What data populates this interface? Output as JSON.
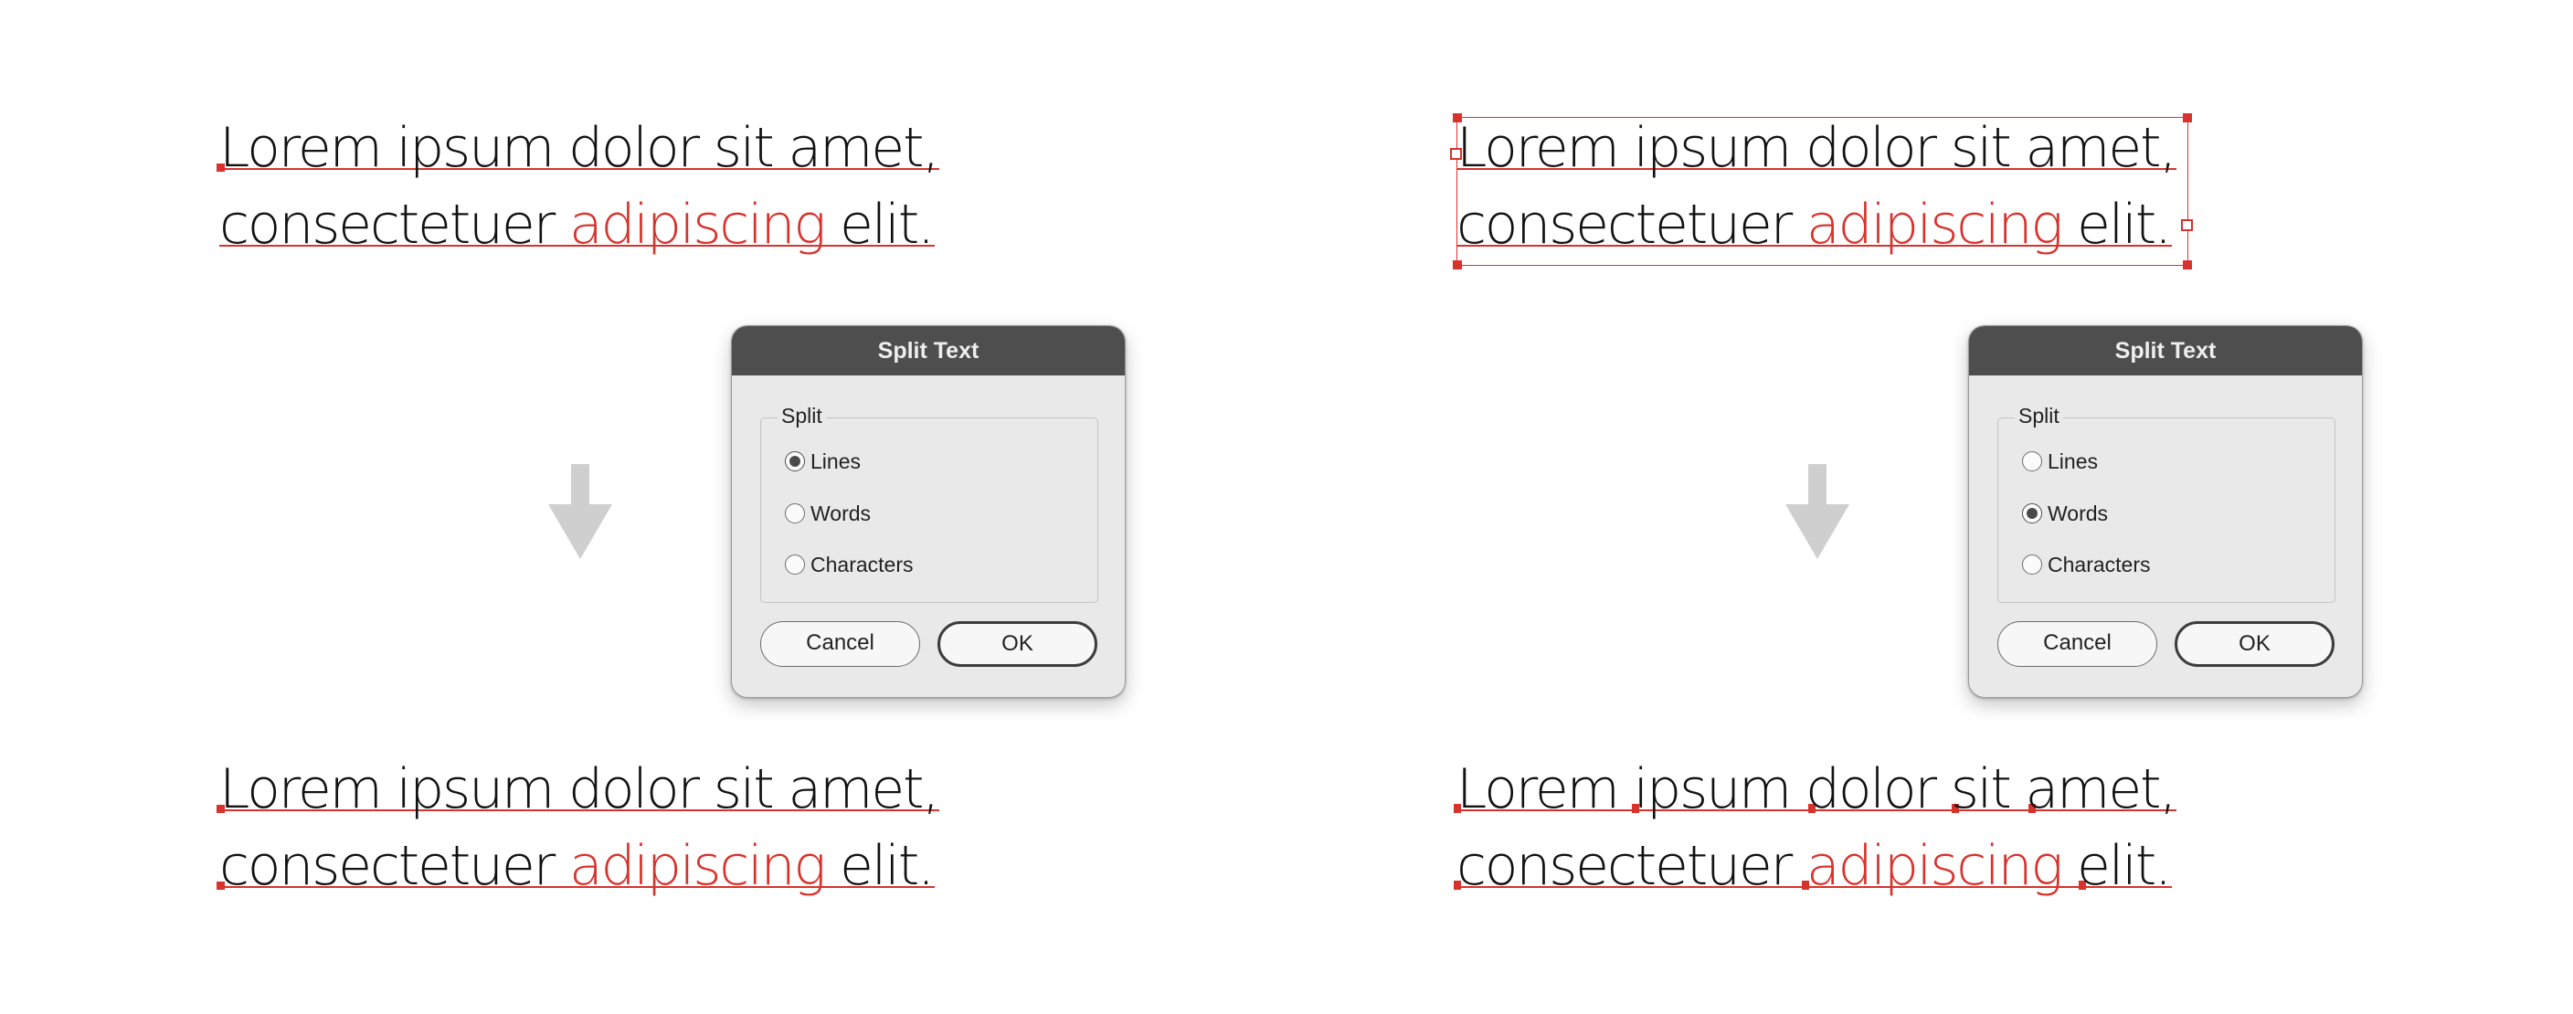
{
  "sample": {
    "line1": "Lorem ipsum dolor sit amet,",
    "line2_start": "consectetuer ",
    "line2_highlight": "adipiscing",
    "line2_end": " elit."
  },
  "panels": [
    {
      "dialog": {
        "title": "Split Text",
        "group_label": "Split",
        "options": [
          "Lines",
          "Words",
          "Characters"
        ],
        "selected": "Lines",
        "cancel_label": "Cancel",
        "ok_label": "OK"
      }
    },
    {
      "dialog": {
        "title": "Split Text",
        "group_label": "Split",
        "options": [
          "Lines",
          "Words",
          "Characters"
        ],
        "selected": "Words",
        "cancel_label": "Cancel",
        "ok_label": "OK"
      }
    }
  ],
  "colors": {
    "accent": "#d8322c",
    "titlebar": "#4f4e4e",
    "dialog_bg": "#e9e9e9",
    "arrow": "#cfcfcf"
  },
  "icons": {
    "arrow": "arrow-down-icon"
  }
}
